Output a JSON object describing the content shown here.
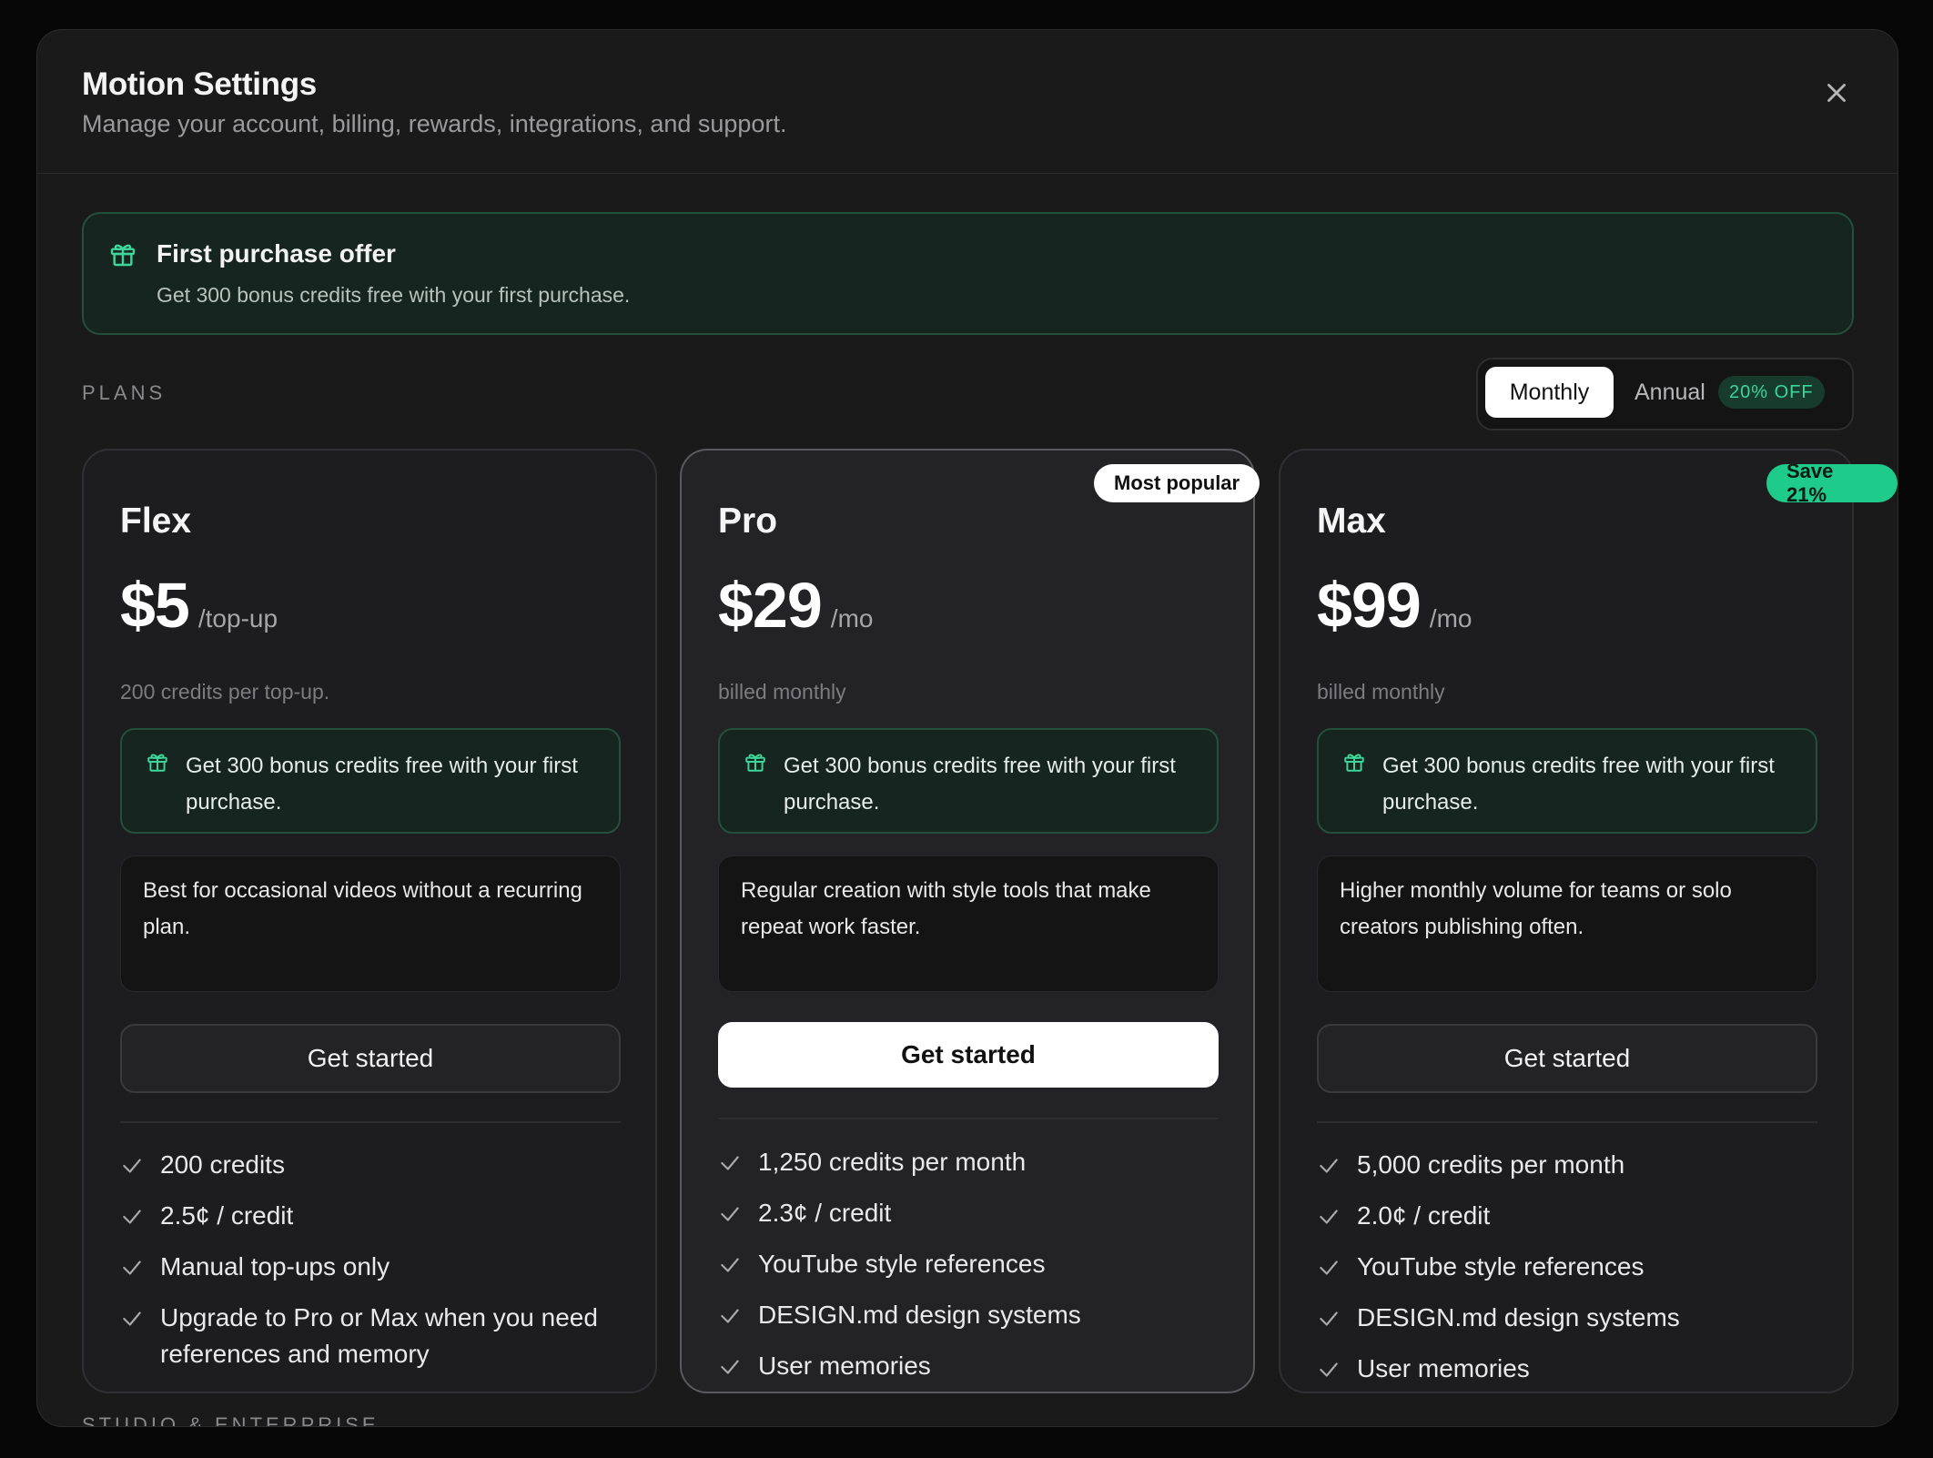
{
  "modal": {
    "title": "Motion Settings",
    "subtitle": "Manage your account, billing, rewards, integrations, and support."
  },
  "offer": {
    "title": "First purchase offer",
    "description": "Get 300 bonus credits free with your first purchase."
  },
  "plans_label": "PLANS",
  "billing_toggle": {
    "monthly": "Monthly",
    "annual": "Annual",
    "annual_badge": "20% OFF",
    "selected": "Monthly"
  },
  "plans": [
    {
      "name": "Flex",
      "price": "$5",
      "period": "/top-up",
      "billing": "200 credits per top-up.",
      "bonus": "Get 300 bonus credits free with your first purchase.",
      "description": "Best for occasional videos without a recurring plan.",
      "cta": "Get started",
      "features": [
        "200 credits",
        "2.5¢ / credit",
        "Manual top-ups only",
        "Upgrade to Pro or Max when you need references and memory"
      ]
    },
    {
      "name": "Pro",
      "badge": "Most popular",
      "price": "$29",
      "period": "/mo",
      "billing": "billed monthly",
      "bonus": "Get 300 bonus credits free with your first purchase.",
      "description": "Regular creation with style tools that make repeat work faster.",
      "cta": "Get started",
      "features": [
        "1,250 credits per month",
        "2.3¢ / credit",
        "YouTube style references",
        "DESIGN.md design systems",
        "User memories"
      ]
    },
    {
      "name": "Max",
      "badge": "Save 21%",
      "price": "$99",
      "period": "/mo",
      "billing": "billed monthly",
      "bonus": "Get 300 bonus credits free with your first purchase.",
      "description": "Higher monthly volume for teams or solo creators publishing often.",
      "cta": "Get started",
      "features": [
        "5,000 credits per month",
        "2.0¢ / credit",
        "YouTube style references",
        "DESIGN.md design systems",
        "User memories"
      ]
    }
  ],
  "next_section_label": "STUDIO & ENTERPRISE",
  "colors": {
    "accent_green": "#1ecb8a",
    "offer_bg": "#16251f",
    "modal_bg": "#1a1a1b"
  }
}
